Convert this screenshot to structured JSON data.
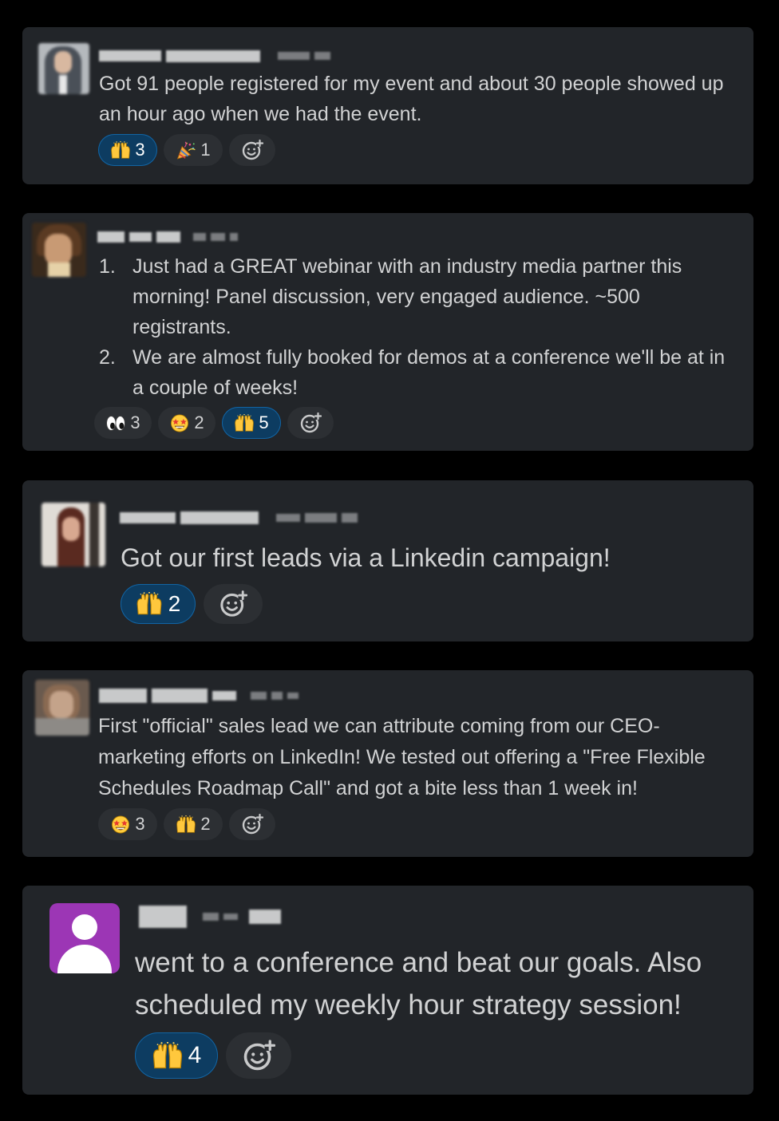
{
  "colors": {
    "background": "#000000",
    "card": "#222529",
    "text": "#d1d2d3",
    "reaction_pill": "#2c2f33",
    "reaction_active": "#0d3c61",
    "reaction_active_border": "#1264a3",
    "profile_placeholder": "#9c36b5"
  },
  "messages": [
    {
      "text": "Got 91 people registered for my event and about 30 people showed up an hour ago when we had the event.",
      "reactions": [
        {
          "icon": "raised-hands-icon",
          "count": "3",
          "active": true
        },
        {
          "icon": "party-popper-icon",
          "count": "1",
          "active": false
        }
      ]
    },
    {
      "list_items": [
        {
          "num": "1.",
          "text": "Just had a GREAT webinar with an industry media partner this morning! Panel discussion, very engaged audience. ~500 registrants."
        },
        {
          "num": "2.",
          "text": "We are almost fully booked for demos at a conference we'll be at in a couple of weeks!"
        }
      ],
      "reactions": [
        {
          "icon": "eyes-icon",
          "count": "3",
          "active": false
        },
        {
          "icon": "star-struck-icon",
          "count": "2",
          "active": false
        },
        {
          "icon": "raised-hands-icon",
          "count": "5",
          "active": true
        }
      ]
    },
    {
      "text": "Got our first leads via a Linkedin campaign!",
      "reactions": [
        {
          "icon": "raised-hands-icon",
          "count": "2",
          "active": true
        }
      ]
    },
    {
      "text": "First \"official\" sales lead we can attribute coming from our CEO-marketing efforts on LinkedIn! We tested out offering a \"Free Flexible Schedules Roadmap Call\" and got a bite less than 1 week in!",
      "reactions": [
        {
          "icon": "star-struck-icon",
          "count": "3",
          "active": false
        },
        {
          "icon": "raised-hands-icon",
          "count": "2",
          "active": false
        }
      ]
    },
    {
      "text": "went to a conference and beat our goals.  Also scheduled my weekly hour strategy session!",
      "reactions": [
        {
          "icon": "raised-hands-icon",
          "count": "4",
          "active": true
        }
      ]
    }
  ]
}
